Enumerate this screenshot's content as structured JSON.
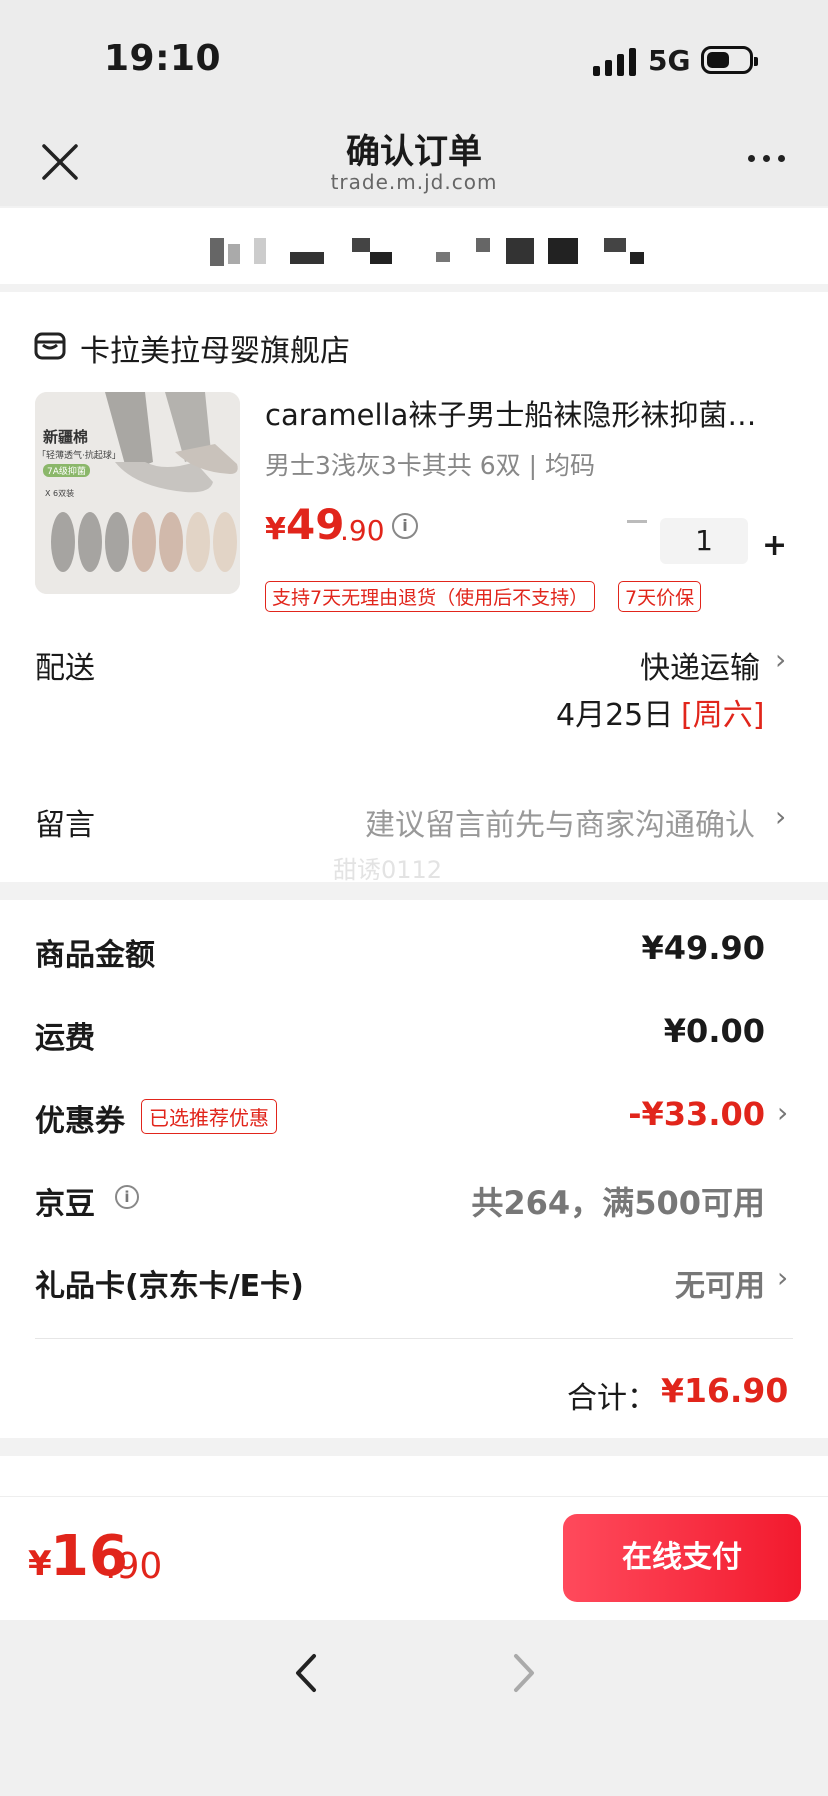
{
  "status": {
    "time": "19:10",
    "network": "5G"
  },
  "header": {
    "title": "确认订单",
    "url": "trade.m.jd.com"
  },
  "store": {
    "name": "卡拉美拉母婴旗舰店",
    "product": {
      "title": "caramella袜子男士船袜隐形袜抑菌…",
      "spec": "男士3浅灰3卡其共 6双 | 均码",
      "price_symbol": "¥",
      "price_int": "49",
      "price_dec": ".90",
      "quantity": "1",
      "tags": [
        "支持7天无理由退货（使用后不支持）",
        "7天价保"
      ],
      "image_text": {
        "brand_label": "新疆棉",
        "sub_label": "「轻薄透气·抗起球」",
        "badge": "7A级抑菌",
        "count": "X 6双装"
      }
    },
    "shipping": {
      "label": "配送",
      "method": "快递运输",
      "date": "4月25日",
      "weekday": "[周六]"
    },
    "message": {
      "label": "留言",
      "placeholder": "建议留言前先与商家沟通确认"
    },
    "watermark": "甜诱0112"
  },
  "summary": {
    "goods_label": "商品金额",
    "goods_value": "¥49.90",
    "freight_label": "运费",
    "freight_value": "¥0.00",
    "coupon_label": "优惠券",
    "coupon_badge": "已选推荐优惠",
    "coupon_value": "-¥33.00",
    "beans_label": "京豆",
    "beans_value": "共264，满500可用",
    "giftcard_label": "礼品卡(京东卡/E卡)",
    "giftcard_value": "无可用",
    "total_label": "合计：",
    "total_value": "¥16.90"
  },
  "paybar": {
    "symbol": "¥",
    "int": "16",
    "dec": ".90",
    "button": "在线支付"
  },
  "colors": {
    "accent": "#e1251b",
    "button": "#f21a2e"
  },
  "icons": [
    "close-icon",
    "more-icon",
    "store-icon",
    "info-icon",
    "chevron-right-icon",
    "back-icon",
    "forward-icon"
  ]
}
